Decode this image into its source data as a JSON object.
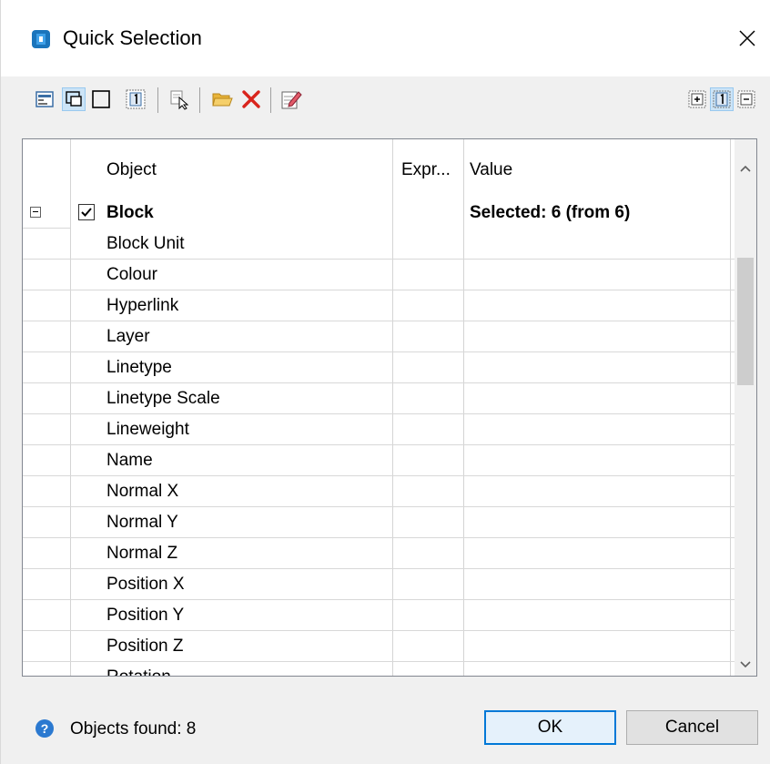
{
  "window": {
    "title": "Quick Selection",
    "close_glyph": "✕"
  },
  "toolbar": {
    "buttons": [
      {
        "name": "select-objects-icon"
      },
      {
        "name": "selection-box-icon",
        "pressed": true
      },
      {
        "name": "rectangle-icon"
      },
      {
        "name": "number-one-icon"
      },
      {
        "name": "select-cursor-icon"
      },
      {
        "name": "open-folder-icon"
      },
      {
        "name": "delete-icon"
      },
      {
        "name": "edit-icon"
      },
      {
        "name": "expand-all-icon"
      },
      {
        "name": "number-one-pressed-icon",
        "pressed": true
      },
      {
        "name": "collapse-all-icon"
      }
    ]
  },
  "grid": {
    "headers": {
      "object": "Object",
      "expression": "Expr...",
      "value": "Value"
    },
    "group": {
      "expander": "−",
      "checked": true,
      "label": "Block",
      "value": "Selected: 6 (from 6)"
    },
    "properties": [
      "Block Unit",
      "Colour",
      "Hyperlink",
      "Layer",
      "Linetype",
      "Linetype Scale",
      "Lineweight",
      "Name",
      "Normal X",
      "Normal Y",
      "Normal Z",
      "Position X",
      "Position Y",
      "Position Z",
      "Rotation"
    ]
  },
  "status": {
    "help_glyph": "?",
    "objects_found": "Objects found: 8"
  },
  "buttons": {
    "ok": "OK",
    "cancel": "Cancel"
  },
  "colors": {
    "accent": "#0078d7",
    "delete_red": "#d9241c",
    "folder_yellow": "#e8b43a",
    "app_blue": "#1b75bc"
  }
}
